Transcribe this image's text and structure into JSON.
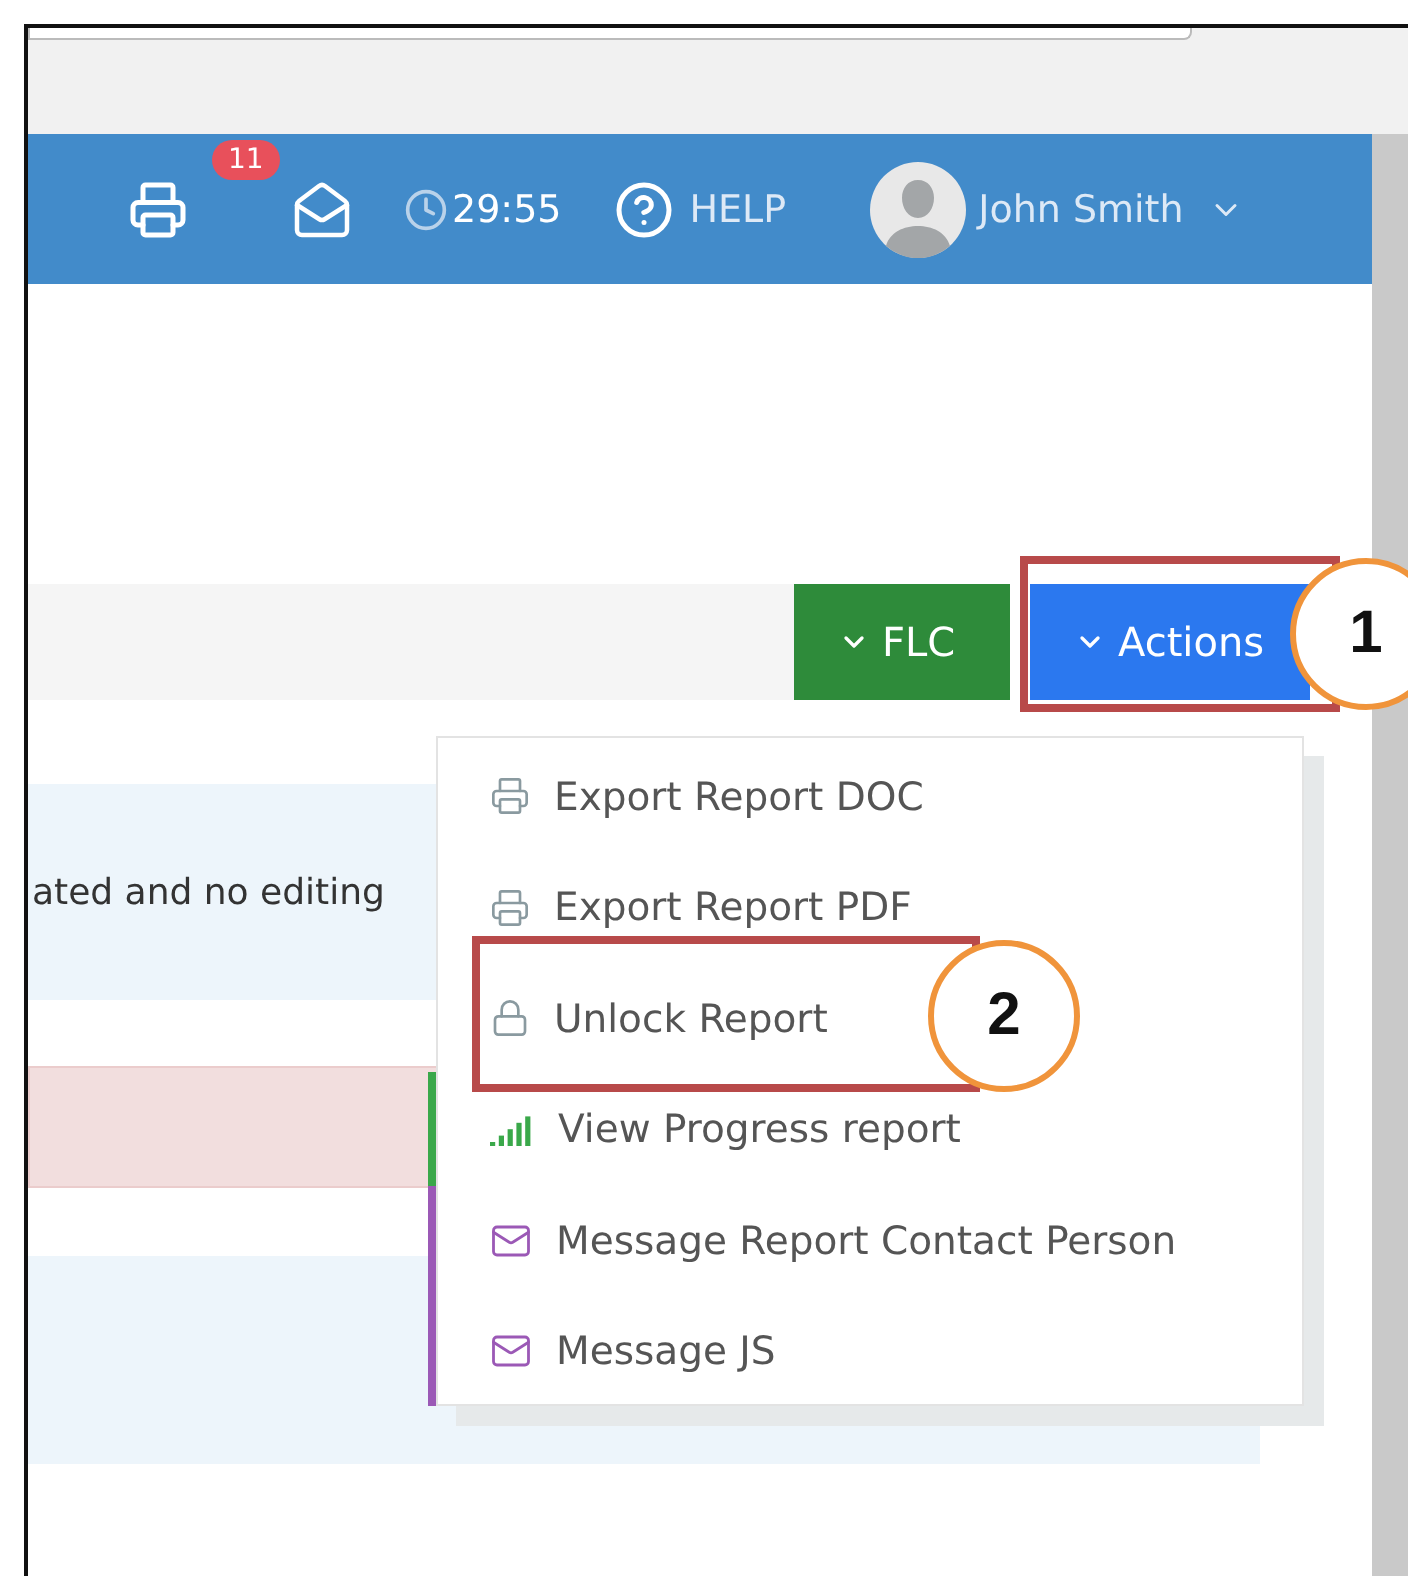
{
  "header": {
    "notification_count": "11",
    "timer": "29:55",
    "help": "HELP",
    "user": "John Smith"
  },
  "toolbar": {
    "buttons": [
      {
        "label": "FLC",
        "kind": "green"
      },
      {
        "label": "Actions",
        "kind": "blue"
      }
    ]
  },
  "notice": {
    "text": "ated and no editing"
  },
  "actions_menu": {
    "items": [
      {
        "label": "Export Report DOC",
        "kind": "export"
      },
      {
        "label": "Export Report PDF",
        "kind": "export"
      },
      {
        "label": "Unlock Report",
        "kind": "unlock"
      },
      {
        "label": "View Progress report",
        "kind": "progress"
      },
      {
        "label": "Message Report Contact Person",
        "kind": "message"
      },
      {
        "label": "Message JS",
        "kind": "message"
      }
    ]
  },
  "annotations": [
    {
      "number": "1"
    },
    {
      "number": "2"
    }
  ]
}
